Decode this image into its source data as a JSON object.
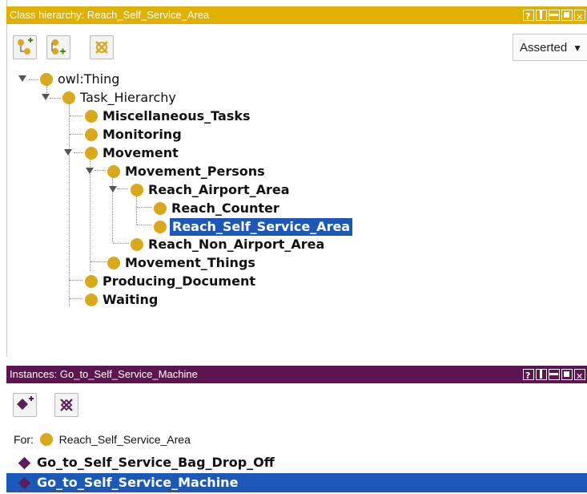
{
  "colors": {
    "class_header": "#e0b000",
    "instances_header": "#5c1550",
    "selection": "#1b58b8",
    "class_dot": "#d9a81b",
    "individual": "#5a1e5a"
  },
  "class_panel": {
    "title": "Class hierarchy: Reach_Self_Service_Area",
    "window_controls": [
      "help-icon",
      "split-vertical-icon",
      "split-horizontal-icon",
      "maximize-icon",
      "close-icon"
    ],
    "toolbar": {
      "add_subclass_icon": "add-subclass-icon",
      "add_sibling_icon": "add-sibling-class-icon",
      "delete_icon": "delete-class-icon",
      "view_mode": "Asserted"
    },
    "tree": [
      {
        "label": "owl:Thing",
        "bold": false
      },
      {
        "label": "Task_Hierarchy",
        "bold": false
      },
      {
        "label": "Miscellaneous_Tasks",
        "bold": true
      },
      {
        "label": "Monitoring",
        "bold": true
      },
      {
        "label": "Movement",
        "bold": true
      },
      {
        "label": "Movement_Persons",
        "bold": true
      },
      {
        "label": "Reach_Airport_Area",
        "bold": true
      },
      {
        "label": "Reach_Counter",
        "bold": true
      },
      {
        "label": "Reach_Self_Service_Area",
        "bold": true,
        "selected": true
      },
      {
        "label": "Reach_Non_Airport_Area",
        "bold": true
      },
      {
        "label": "Movement_Things",
        "bold": true
      },
      {
        "label": "Producing_Document",
        "bold": true
      },
      {
        "label": "Waiting",
        "bold": true
      }
    ]
  },
  "instances_panel": {
    "title": "Instances: Go_to_Self_Service_Machine",
    "toolbar": {
      "add_icon": "add-individual-icon",
      "delete_icon": "delete-individual-icon"
    },
    "for_label": "For:",
    "for_class": "Reach_Self_Service_Area",
    "items": [
      {
        "label": "Go_to_Self_Service_Bag_Drop_Off",
        "selected": false
      },
      {
        "label": "Go_to_Self_Service_Machine",
        "selected": true
      }
    ]
  }
}
